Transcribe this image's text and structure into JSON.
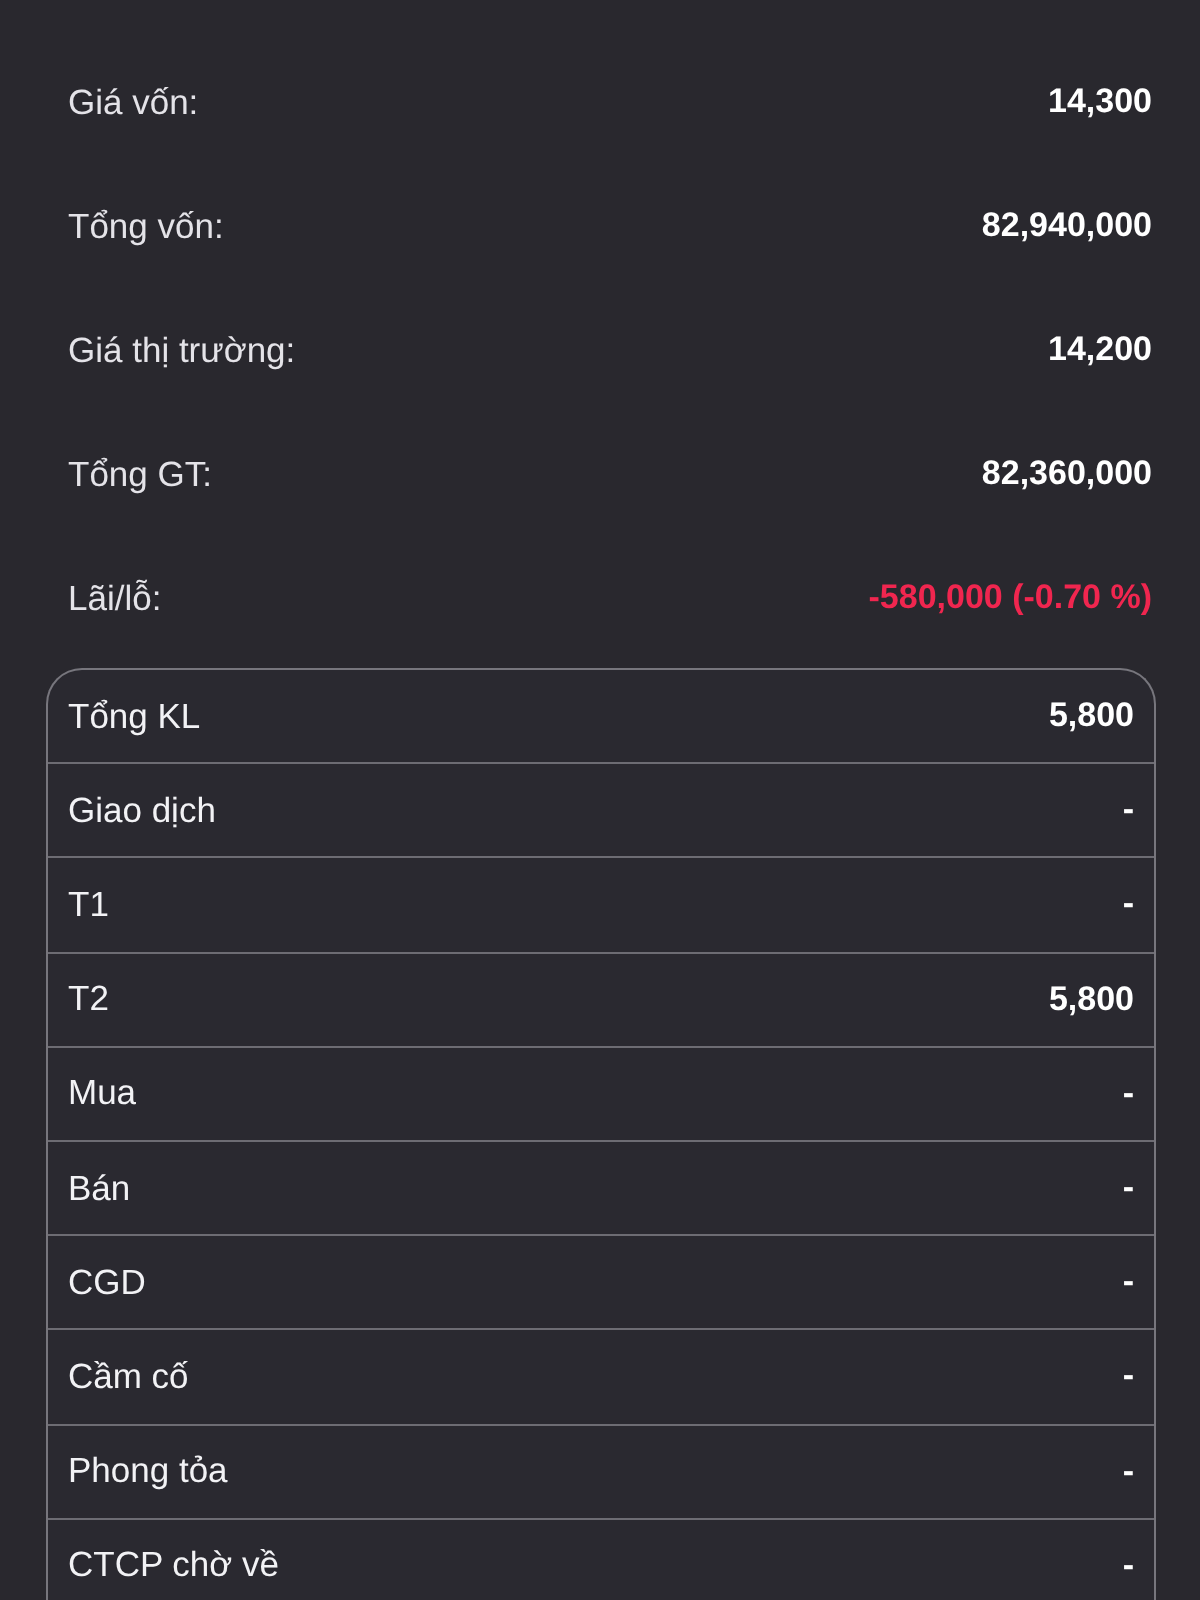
{
  "summary": [
    {
      "label": "Giá vốn:",
      "value": "14,300",
      "kind": "plain"
    },
    {
      "label": "Tổng vốn:",
      "value": "82,940,000",
      "kind": "plain"
    },
    {
      "label": "Giá thị trường:",
      "value": "14,200",
      "kind": "plain"
    },
    {
      "label": "Tổng GT:",
      "value": "82,360,000",
      "kind": "plain"
    },
    {
      "label": "Lãi/lỗ:",
      "value": "-580,000 (-0.70 %)",
      "kind": "loss"
    }
  ],
  "volume_table": {
    "rows": [
      {
        "label": "Tổng KL",
        "value": "5,800"
      },
      {
        "label": "Giao dịch",
        "value": "-"
      },
      {
        "label": "T1",
        "value": "-"
      },
      {
        "label": "T2",
        "value": "5,800"
      },
      {
        "label": "Mua",
        "value": "-"
      },
      {
        "label": "Bán",
        "value": "-"
      },
      {
        "label": "CGD",
        "value": "-"
      },
      {
        "label": "Cầm cố",
        "value": "-"
      },
      {
        "label": "Phong tỏa",
        "value": "-"
      },
      {
        "label": "CTCP chờ về",
        "value": "-"
      }
    ]
  }
}
